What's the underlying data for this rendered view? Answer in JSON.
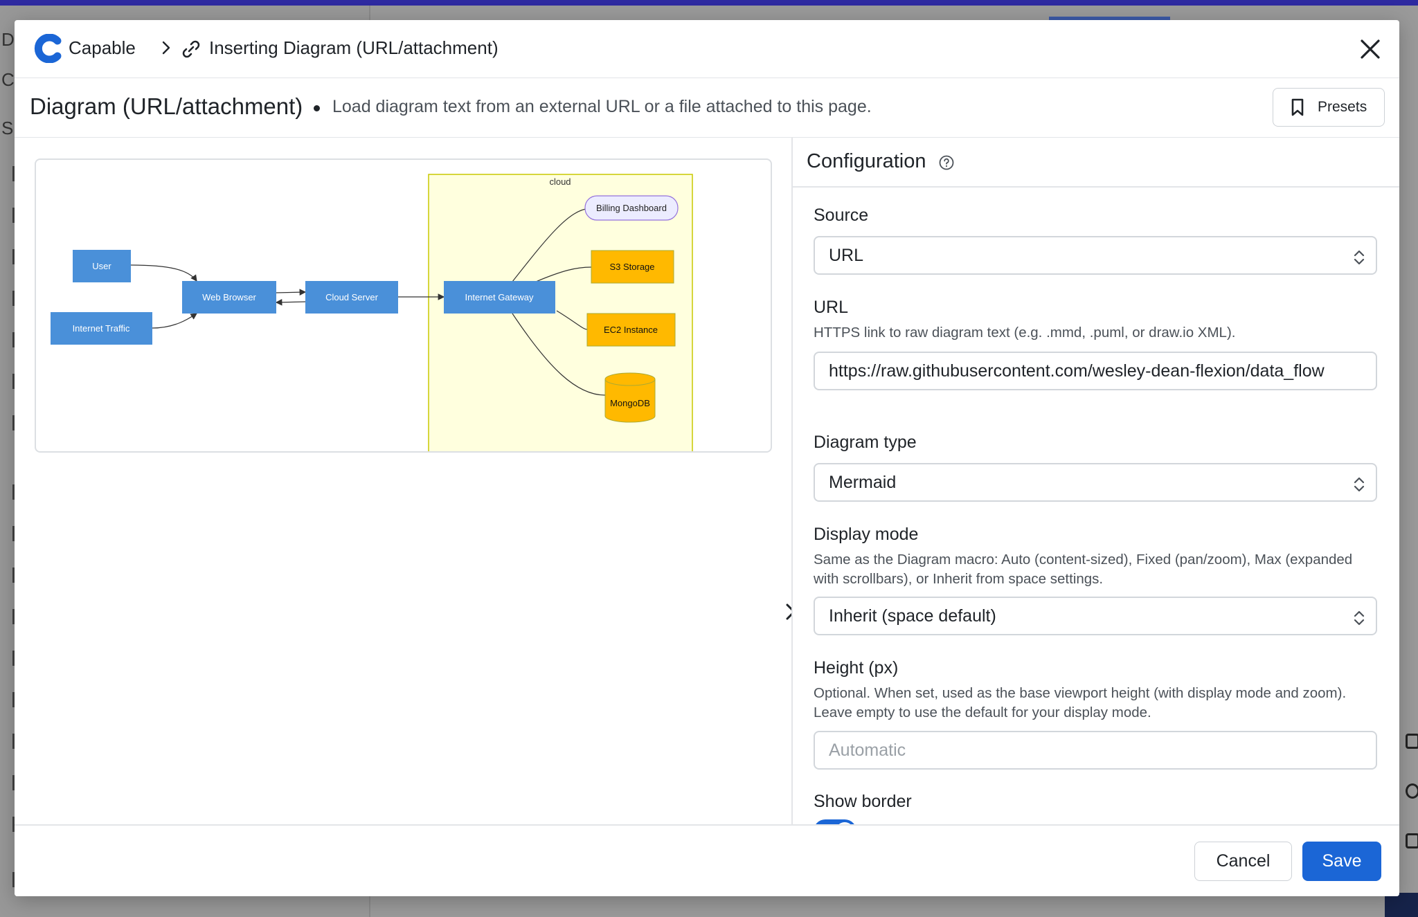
{
  "background": {
    "sidebar_fragments": [
      "Dia",
      "Co",
      "S"
    ]
  },
  "header": {
    "app_name": "Capable",
    "breadcrumb_title": "Inserting Diagram (URL/attachment)"
  },
  "subheader": {
    "title": "Diagram (URL/attachment)",
    "description": "Load diagram text from an external URL or a file attached to this page.",
    "presets_label": "Presets"
  },
  "diagram": {
    "cluster_label": "cloud",
    "nodes": {
      "user": "User",
      "internet_traffic": "Internet Traffic",
      "web_browser": "Web Browser",
      "cloud_server": "Cloud Server",
      "internet_gateway": "Internet Gateway",
      "billing_dashboard": "Billing Dashboard",
      "s3_storage": "S3 Storage",
      "ec2_instance": "EC2 Instance",
      "mongodb": "MongoDB"
    },
    "colors": {
      "blue_node": "#4a90d9",
      "orange_node": "#ffb900",
      "cluster_fill": "#ffffde",
      "cluster_stroke": "#c8c800",
      "pill_fill": "#ececff"
    }
  },
  "config": {
    "title": "Configuration",
    "source": {
      "label": "Source",
      "value": "URL"
    },
    "url": {
      "label": "URL",
      "help": "HTTPS link to raw diagram text (e.g. .mmd, .puml, or draw.io XML).",
      "value": "https://raw.githubusercontent.com/wesley-dean-flexion/data_flow"
    },
    "diagram_type": {
      "label": "Diagram type",
      "value": "Mermaid"
    },
    "display_mode": {
      "label": "Display mode",
      "help": "Same as the Diagram macro: Auto (content-sized), Fixed (pan/zoom), Max (expanded with scrollbars), or Inherit from space settings.",
      "value": "Inherit (space default)"
    },
    "height": {
      "label": "Height (px)",
      "help": "Optional. When set, used as the base viewport height (with display mode and zoom). Leave empty to use the default for your display mode.",
      "placeholder": "Automatic"
    },
    "show_border": {
      "label": "Show border",
      "enabled": true
    }
  },
  "footer": {
    "cancel_label": "Cancel",
    "save_label": "Save"
  },
  "accent_color": "#1b66d6"
}
